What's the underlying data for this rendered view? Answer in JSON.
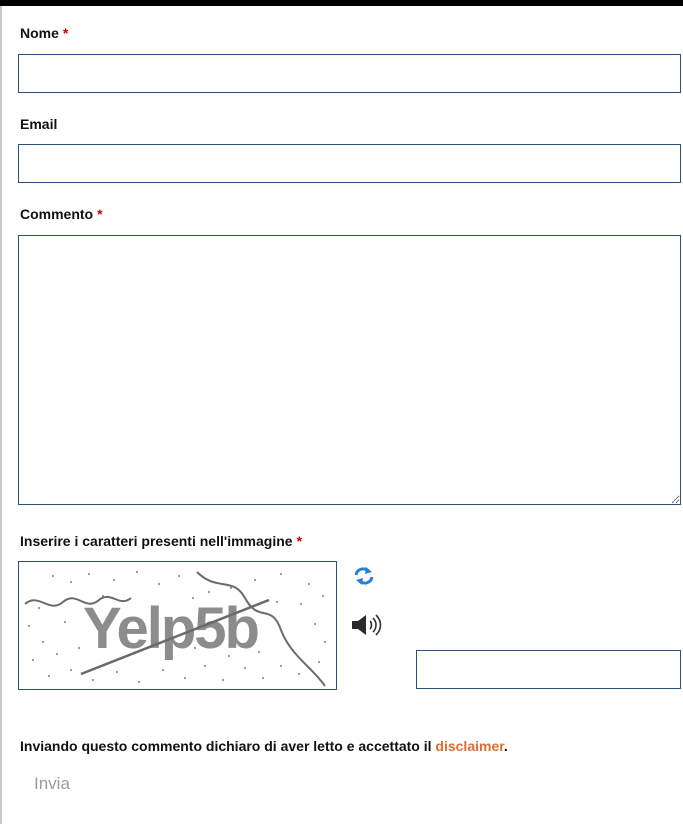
{
  "form": {
    "name": {
      "label": "Nome",
      "required_marker": "*",
      "value": ""
    },
    "email": {
      "label": "Email",
      "value": ""
    },
    "comment": {
      "label": "Commento",
      "required_marker": "*",
      "value": ""
    },
    "captcha": {
      "label": "Inserire i caratteri presenti nell'immagine",
      "required_marker": "*",
      "image_text": "Yelp5b",
      "refresh_icon": "refresh-icon",
      "audio_icon": "speaker-icon",
      "value": ""
    },
    "disclaimer": {
      "prefix": "Inviando questo commento dichiaro di aver letto e accettato il ",
      "link_text": "disclaimer",
      "suffix": "."
    },
    "submit_label": "Invia"
  },
  "colors": {
    "required": "#d20000",
    "link": "#e06d34",
    "field_border": "#2c4f7c",
    "submit_text": "#9a9a9a"
  }
}
